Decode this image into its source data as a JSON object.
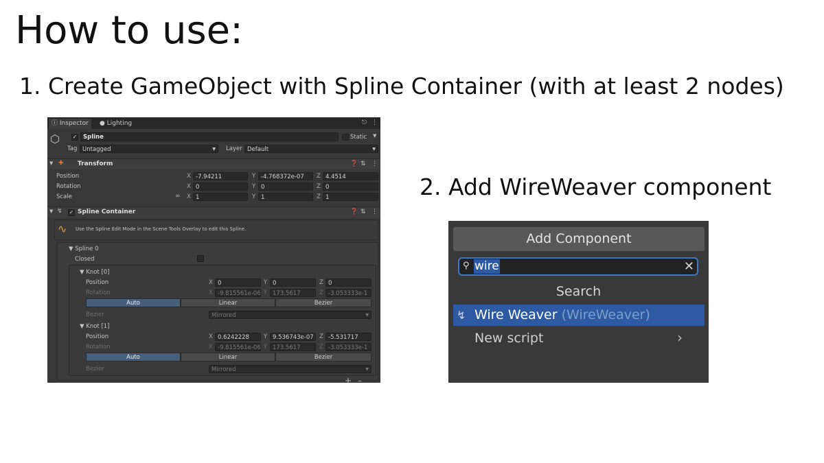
{
  "page": {
    "title": "How to use:",
    "step1": "1. Create GameObject with Spline Container (with at least 2 nodes)",
    "step2": "2. Add WireWeaver component"
  },
  "inspector": {
    "tabs": [
      "Inspector",
      "Lighting"
    ],
    "object_name": "Spline",
    "static_label": "Static",
    "tag_label": "Tag",
    "tag_value": "Untagged",
    "layer_label": "Layer",
    "layer_value": "Default",
    "transform": {
      "title": "Transform",
      "position_label": "Position",
      "rotation_label": "Rotation",
      "scale_label": "Scale",
      "position": {
        "x": "-7.94211",
        "y": "-4.768372e-07",
        "z": "4.4514"
      },
      "rotation": {
        "x": "0",
        "y": "0",
        "z": "0"
      },
      "scale": {
        "x": "1",
        "y": "1",
        "z": "1"
      }
    },
    "spline_container": {
      "title": "Spline Container",
      "help": "Use the Spline Edit Mode in the Scene Tools Overlay to edit this Spline.",
      "spline_label": "Spline 0",
      "closed_label": "Closed",
      "knots": [
        {
          "title": "Knot [0]",
          "position_label": "Position",
          "rotation_label": "Rotation",
          "bezier_label": "Bezier",
          "position": {
            "x": "0",
            "y": "0",
            "z": "0"
          },
          "rotation": {
            "x": "-9.815561e-06",
            "y": "173.5617",
            "z": "-3.053333e-1"
          },
          "modes": [
            "Auto",
            "Linear",
            "Bezier"
          ],
          "bezier_value": "Mirrored"
        },
        {
          "title": "Knot [1]",
          "position_label": "Position",
          "rotation_label": "Rotation",
          "bezier_label": "Bezier",
          "position": {
            "x": "0.6242228",
            "y": "9.536743e-07",
            "z": "-5.531717"
          },
          "rotation": {
            "x": "-9.815561e-06",
            "y": "173.5617",
            "z": "-3.053333e-1"
          },
          "modes": [
            "Auto",
            "Linear",
            "Bezier"
          ],
          "bezier_value": "Mirrored"
        }
      ]
    }
  },
  "add_component": {
    "title": "Add Component",
    "search_value": "wire",
    "section": "Search",
    "result_name": "Wire Weaver",
    "result_class": "(WireWeaver)",
    "new_script": "New script"
  },
  "colors": {
    "accent": "#2e5aa4",
    "search_border": "#3e79c0",
    "panel_bg": "#383838",
    "active_mode": "#46607c"
  }
}
